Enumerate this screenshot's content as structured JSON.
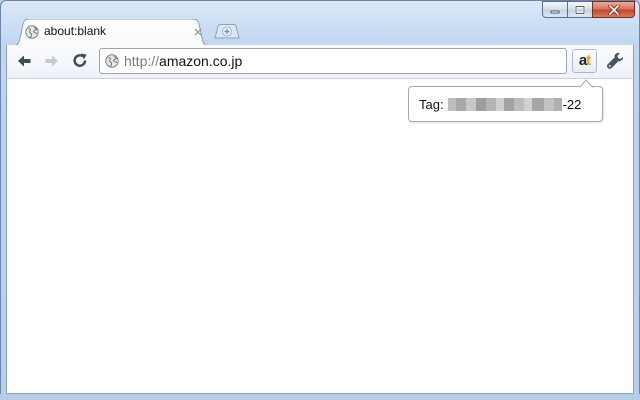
{
  "window": {
    "caption_buttons": [
      "minimize",
      "maximize",
      "close"
    ]
  },
  "tab": {
    "title": "about:blank",
    "close_glyph": "×",
    "favicon": "globe-icon"
  },
  "toolbar": {
    "back_icon": "back-arrow-icon",
    "forward_icon": "forward-arrow-icon",
    "reload_icon": "reload-icon",
    "omnibox": {
      "scheme": "http://",
      "host": "amazon.co.jp",
      "icon": "globe-icon"
    },
    "extension": {
      "letter_a": "a",
      "letter_t": "t",
      "accent_color": "#f09a2a"
    },
    "menu_icon": "wrench-icon"
  },
  "popup": {
    "label": "Tag:",
    "suffix": "-22"
  }
}
